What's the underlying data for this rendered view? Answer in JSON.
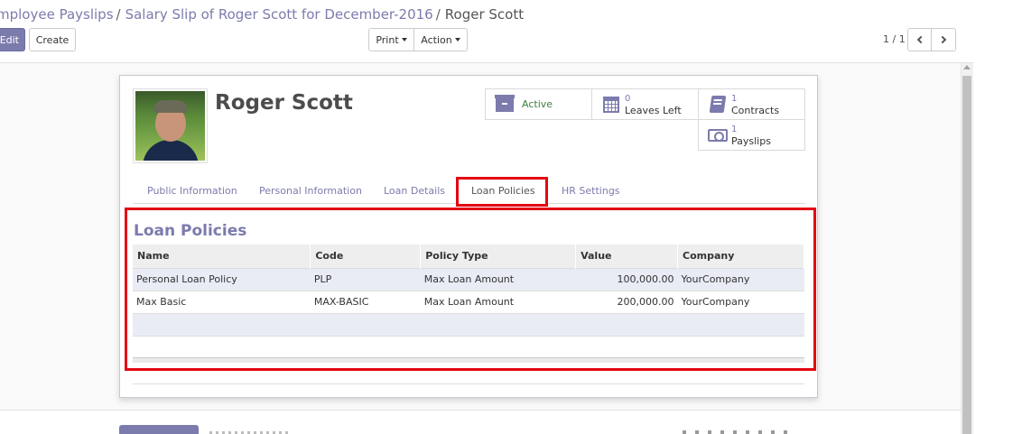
{
  "breadcrumb": {
    "items": [
      "mployee Payslips",
      "Salary Slip of Roger Scott for December-2016"
    ],
    "separator": "/",
    "current": "Roger Scott"
  },
  "toolbar": {
    "edit_label": "Edit",
    "create_label": "Create",
    "print_label": "Print",
    "action_label": "Action"
  },
  "pager": {
    "value": "1 / 1"
  },
  "employee": {
    "name": "Roger Scott"
  },
  "smart_buttons": {
    "active": {
      "label": "Active",
      "icon": "archive-icon"
    },
    "leaves": {
      "count": "0",
      "label": "Leaves Left",
      "icon": "calendar-icon"
    },
    "contracts": {
      "count": "1",
      "label": "Contracts",
      "icon": "book-icon"
    },
    "payslips": {
      "count": "1",
      "label": "Payslips",
      "icon": "money-icon"
    }
  },
  "tabs": [
    "Public Information",
    "Personal Information",
    "Loan Details",
    "Loan Policies",
    "HR Settings"
  ],
  "active_tab": "Loan Policies",
  "loan_policies": {
    "title": "Loan Policies",
    "columns": [
      "Name",
      "Code",
      "Policy Type",
      "Value",
      "Company"
    ],
    "rows": [
      {
        "name": "Personal Loan Policy",
        "code": "PLP",
        "policy_type": "Max Loan Amount",
        "value": "100,000.00",
        "company": "YourCompany"
      },
      {
        "name": "Max Basic",
        "code": "MAX-BASIC",
        "policy_type": "Max Loan Amount",
        "value": "200,000.00",
        "company": "YourCompany"
      }
    ]
  },
  "colors": {
    "accent": "#7c7bad",
    "highlight": "#e30613",
    "active_status": "#3c7d3c"
  }
}
